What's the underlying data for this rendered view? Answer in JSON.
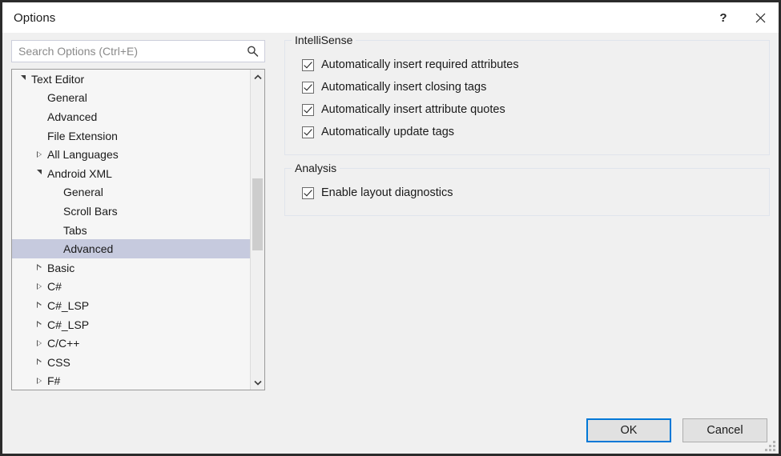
{
  "window": {
    "title": "Options",
    "help_icon": "help-icon",
    "close_icon": "close-icon"
  },
  "search": {
    "placeholder": "Search Options (Ctrl+E)",
    "value": "",
    "icon": "search-icon"
  },
  "tree": {
    "items": [
      {
        "label": "Text Editor",
        "level": 0,
        "state": "expanded",
        "selected": false
      },
      {
        "label": "General",
        "level": 1,
        "state": "leaf",
        "selected": false
      },
      {
        "label": "Advanced",
        "level": 1,
        "state": "leaf",
        "selected": false
      },
      {
        "label": "File Extension",
        "level": 1,
        "state": "leaf",
        "selected": false
      },
      {
        "label": "All Languages",
        "level": 1,
        "state": "collapsed",
        "selected": false
      },
      {
        "label": "Android XML",
        "level": 1,
        "state": "expanded",
        "selected": false
      },
      {
        "label": "General",
        "level": 2,
        "state": "leaf",
        "selected": false
      },
      {
        "label": "Scroll Bars",
        "level": 2,
        "state": "leaf",
        "selected": false
      },
      {
        "label": "Tabs",
        "level": 2,
        "state": "leaf",
        "selected": false
      },
      {
        "label": "Advanced",
        "level": 2,
        "state": "leaf",
        "selected": true
      },
      {
        "label": "Basic",
        "level": 1,
        "state": "collapsed",
        "selected": false
      },
      {
        "label": "C#",
        "level": 1,
        "state": "collapsed",
        "selected": false
      },
      {
        "label": "C#_LSP",
        "level": 1,
        "state": "collapsed",
        "selected": false
      },
      {
        "label": "C#_LSP",
        "level": 1,
        "state": "collapsed",
        "selected": false
      },
      {
        "label": "C/C++",
        "level": 1,
        "state": "collapsed",
        "selected": false
      },
      {
        "label": "CSS",
        "level": 1,
        "state": "collapsed",
        "selected": false
      },
      {
        "label": "F#",
        "level": 1,
        "state": "collapsed",
        "selected": false
      }
    ],
    "scrollbar": {
      "up_icon": "chevron-up-icon",
      "down_icon": "chevron-down-icon"
    }
  },
  "panel": {
    "groups": [
      {
        "title": "IntelliSense",
        "options": [
          {
            "label": "Automatically insert required attributes",
            "checked": true
          },
          {
            "label": "Automatically insert closing tags",
            "checked": true
          },
          {
            "label": "Automatically insert attribute quotes",
            "checked": true
          },
          {
            "label": "Automatically update tags",
            "checked": true
          }
        ]
      },
      {
        "title": "Analysis",
        "options": [
          {
            "label": "Enable layout diagnostics",
            "checked": true
          }
        ]
      }
    ]
  },
  "footer": {
    "ok_label": "OK",
    "cancel_label": "Cancel"
  },
  "colors": {
    "accent": "#0078d7",
    "selection": "#c6cade",
    "dialog_bg": "#f0f0f0",
    "tree_bg": "#f6f6f6"
  }
}
